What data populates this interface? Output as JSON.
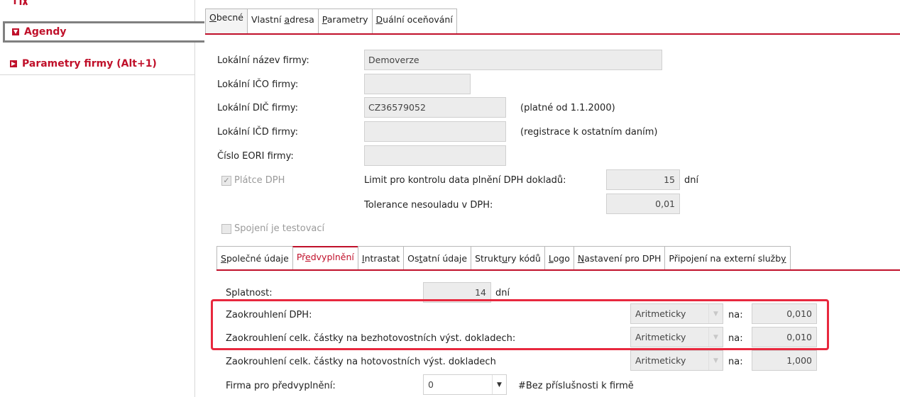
{
  "sidebar": {
    "items": [
      {
        "label": "Agendy",
        "active": true
      },
      {
        "label": "Parametry firmy (Alt+1)",
        "active": false
      }
    ]
  },
  "tabs_top": [
    {
      "pre": "",
      "u": "O",
      "post": "becné",
      "active": true
    },
    {
      "pre": "Vlastní ",
      "u": "a",
      "post": "dresa",
      "active": false
    },
    {
      "pre": "",
      "u": "P",
      "post": "arametry",
      "active": false
    },
    {
      "pre": "",
      "u": "D",
      "post": "uální oceňování",
      "active": false
    }
  ],
  "general": {
    "local_name_label": "Lokální název firmy:",
    "local_name_value": "Demoverze",
    "local_ico_label": "Lokální IČO firmy:",
    "local_ico_value": "",
    "local_dic_label": "Lokální DIČ firmy:",
    "local_dic_value": "CZ36579052",
    "local_dic_note": "(platné od 1.1.2000)",
    "local_icd_label": "Lokální IČD firmy:",
    "local_icd_value": "",
    "local_icd_note": "(registrace k ostatním daním)",
    "eori_label": "Číslo EORI firmy:",
    "eori_value": "",
    "vat_payer_label": "Plátce DPH",
    "vat_payer_checked": true,
    "vat_limit_label": "Limit pro kontrolu data plnění DPH dokladů:",
    "vat_limit_value": "15",
    "vat_limit_unit": "dní",
    "vat_tolerance_label": "Tolerance nesouladu v DPH:",
    "vat_tolerance_value": "0,01",
    "test_conn_label": "Spojení je testovací",
    "test_conn_checked": false
  },
  "tabs_low": [
    {
      "pre": "",
      "u": "S",
      "post": "polečné údaje",
      "active": false
    },
    {
      "pre": "Př",
      "u": "e",
      "post": "dvyplnění",
      "active": true
    },
    {
      "pre": "",
      "u": "I",
      "post": "ntrastat",
      "active": false
    },
    {
      "pre": "Os",
      "u": "t",
      "post": "atní údaje",
      "active": false
    },
    {
      "pre": "Strukt",
      "u": "u",
      "post": "ry kódů",
      "active": false
    },
    {
      "pre": "",
      "u": "L",
      "post": "ogo",
      "active": false
    },
    {
      "pre": "",
      "u": "N",
      "post": "astavení pro DPH",
      "active": false
    },
    {
      "pre": "Připojení na externí služb",
      "u": "y",
      "post": "",
      "active": false
    }
  ],
  "prefill": {
    "due_label": "Splatnost:",
    "due_value": "14",
    "due_unit": "dní",
    "rows": [
      {
        "label": "Zaokrouhlení DPH:",
        "method": "Aritmeticky",
        "na": "na:",
        "value": "0,010"
      },
      {
        "label": "Zaokrouhlení celk. částky na bezhotovostních výst. dokladech:",
        "method": "Aritmeticky",
        "na": "na:",
        "value": "0,010"
      },
      {
        "label": "Zaokrouhlení celk. částky na hotovostních výst. dokladech",
        "method": "Aritmeticky",
        "na": "na:",
        "value": "1,000"
      }
    ],
    "firm_label": "Firma pro předvyplnění:",
    "firm_value": "0",
    "firm_note": "#Bez příslušnosti k firmě"
  },
  "colors": {
    "accent": "#c0102a",
    "highlight": "#e8283e"
  }
}
